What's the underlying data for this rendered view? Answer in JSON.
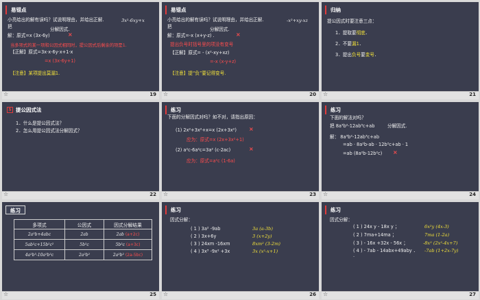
{
  "slides": [
    {
      "num": "19",
      "header": "易错点",
      "lines": [
        {
          "text": "小亮给出的解有误吗？试说明理由，并给出正解.",
          "cls": ""
        },
        {
          "text": "3x²-6xy+x",
          "cls": "mono"
        },
        {
          "text": "把",
          "cls": ""
        },
        {
          "text": "分解因式.",
          "cls": ""
        },
        {
          "text": "解：原式=x (3x-6y)",
          "cls": ""
        },
        {
          "text": "×",
          "cls": "x"
        },
        {
          "text": "当多项式的某一项和公因式相同时，提公因式后剩余的项是1.",
          "cls": "red"
        },
        {
          "text": "【正解】原式=3x·x-6y·x+1·x",
          "cls": ""
        },
        {
          "text": "=x (3x-6y+1)",
          "cls": "red"
        },
        {
          "text": "【注意】某项提出莫漏1.",
          "cls": "yel"
        }
      ]
    },
    {
      "num": "20",
      "header": "易错点",
      "lines": [
        {
          "text": "小亮给出的解有误吗？试说明理由，并给出正解.",
          "cls": ""
        },
        {
          "text": "-x²+xy-xz",
          "cls": "mono"
        },
        {
          "text": "把",
          "cls": ""
        },
        {
          "text": "分解因式.",
          "cls": ""
        },
        {
          "text": "解：原式=-x (x+y-z) .",
          "cls": ""
        },
        {
          "text": "×",
          "cls": "x"
        },
        {
          "text": "提出负号时括号里的项没有变号",
          "cls": "red"
        },
        {
          "text": "【正解】原式= - (x²-xy+xz)",
          "cls": ""
        },
        {
          "text": "=-x (x-y+z)",
          "cls": "red"
        },
        {
          "text": "【注意】提“负”要记得变号.",
          "cls": "yel"
        }
      ]
    },
    {
      "num": "21",
      "header": "归纳",
      "lines": [
        {
          "text": "提公因式时要注意三点：",
          "cls": ""
        },
        {
          "text": "1．提取要",
          "cls": ""
        },
        {
          "text": "彻底",
          "cls": "yel"
        },
        {
          "text": "．",
          "cls": ""
        },
        {
          "text": "2．不要",
          "cls": ""
        },
        {
          "text": "漏1",
          "cls": "yel"
        },
        {
          "text": "．",
          "cls": ""
        },
        {
          "text": "3．提出",
          "cls": ""
        },
        {
          "text": "负号",
          "cls": "yel"
        },
        {
          "text": "要",
          "cls": ""
        },
        {
          "text": "变号",
          "cls": "yel"
        },
        {
          "text": "．",
          "cls": ""
        }
      ]
    },
    {
      "num": "22",
      "header": "提公因式法",
      "idx": "5",
      "lines": [
        {
          "text": "1．什么是提公因式法？",
          "cls": ""
        },
        {
          "text": "2．怎么用提公因式法分解因式？",
          "cls": ""
        }
      ]
    },
    {
      "num": "23",
      "header": "练习",
      "lines": [
        {
          "text": "下面的分解因式对吗？如不对，请指出原因：",
          "cls": ""
        },
        {
          "text": "(1)  2x²+3x²+x=x (2x+3x²)",
          "cls": ""
        },
        {
          "text": "×",
          "cls": "x"
        },
        {
          "text": "应为：原式=x (2x+3x²+1)",
          "cls": "red"
        },
        {
          "text": "(2)  a²c-6a²c=3a² (c-2ac)",
          "cls": ""
        },
        {
          "text": "×",
          "cls": "x"
        },
        {
          "text": "应为：原式=a²c (1-6a)",
          "cls": "red"
        }
      ]
    },
    {
      "num": "24",
      "header": "练习",
      "lines": [
        {
          "text": "下面的解法对吗？",
          "cls": ""
        },
        {
          "text": "把 8a³b²-12ab³c+ab",
          "cls": ""
        },
        {
          "text": "分解因式.",
          "cls": ""
        },
        {
          "text": "解：  8a³b²-12ab³c+ab",
          "cls": ""
        },
        {
          "text": "=ab · 8a²b-ab · 12b²c+ab · 1",
          "cls": ""
        },
        {
          "text": "=ab (8a²b-12b²c)",
          "cls": ""
        },
        {
          "text": "×",
          "cls": "x"
        }
      ]
    },
    {
      "num": "25",
      "header": "练习",
      "table": {
        "headers": [
          "多项式",
          "公因式",
          "因式分解结果"
        ],
        "rows": [
          [
            "2a²b+4abc",
            "2ab",
            "2ab",
            "(a+2c)"
          ],
          [
            "5ab²c+15b²c²",
            "5b²c",
            "5b²c",
            "(a+3c)"
          ],
          [
            "4a²b³-10a²b²c",
            "2a²b²",
            "2a²b²",
            "(2a-5bc)"
          ]
        ]
      }
    },
    {
      "num": "26",
      "header": "练习",
      "lines": [
        {
          "text": "因式分解：",
          "cls": ""
        },
        {
          "text": "( 1 )  3a²  -9ab",
          "cls": ""
        },
        {
          "text": "3a (a-3b)",
          "cls": "yel"
        },
        {
          "text": "( 2 )  3x+6y",
          "cls": ""
        },
        {
          "text": "3 (x+2y)",
          "cls": "yel"
        },
        {
          "text": "( 3 )  24xm  -16xm",
          "cls": ""
        },
        {
          "text": "8xm² (3-2m)",
          "cls": "yel"
        },
        {
          "text": "( 4 )  3x³  -9x²  +3x",
          "cls": ""
        },
        {
          "text": "3x (x²-x+1)",
          "cls": "yel"
        }
      ]
    },
    {
      "num": "27",
      "header": "练习",
      "lines": [
        {
          "text": "因式分解：",
          "cls": ""
        },
        {
          "text": "( 1 ) 24x  y - 18x  y ；",
          "cls": ""
        },
        {
          "text": "6x²y (4x-3)",
          "cls": "yel"
        },
        {
          "text": "( 2 ) 7ma+14ma ；",
          "cls": ""
        },
        {
          "text": "7ma (1-2a)",
          "cls": "yel"
        },
        {
          "text": "( 3 ) - 16x  +32x  - 56x ；",
          "cls": ""
        },
        {
          "text": "-8x² (2x²-4x+7)",
          "cls": "yel"
        },
        {
          "text": "( 4 ) - 7ab - 14abx+49aby ．",
          "cls": ""
        },
        {
          "text": "-7ab (1+2x-7y)",
          "cls": "yel"
        },
        {
          "text": ".",
          "cls": ""
        }
      ]
    }
  ],
  "footer_icon": "star-icon"
}
